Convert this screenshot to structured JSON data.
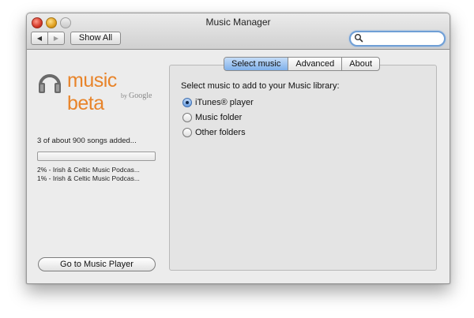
{
  "window": {
    "title": "Music Manager"
  },
  "toolbar": {
    "back_glyph": "◀",
    "forward_glyph": "▶",
    "show_all_label": "Show All",
    "search_value": "",
    "search_icon": "search-icon"
  },
  "logo": {
    "brand_text": "music beta",
    "by_text": "by",
    "google_text": "Google",
    "accent_color": "#e8842a"
  },
  "status": {
    "songs_added": "3 of about 900 songs added...",
    "progress_fraction": 0.003,
    "uploads": [
      "2% - Irish & Celtic Music Podcas...",
      "1% - Irish & Celtic Music Podcas..."
    ]
  },
  "go_to_player_label": "Go to Music Player",
  "tabs": [
    {
      "label": "Select music",
      "active": true
    },
    {
      "label": "Advanced",
      "active": false
    },
    {
      "label": "About",
      "active": false
    }
  ],
  "select_music": {
    "prompt": "Select music to add to your Music library:",
    "options": [
      {
        "label": "iTunes® player",
        "selected": true
      },
      {
        "label": "Music folder",
        "selected": false
      },
      {
        "label": "Other folders",
        "selected": false
      }
    ]
  }
}
